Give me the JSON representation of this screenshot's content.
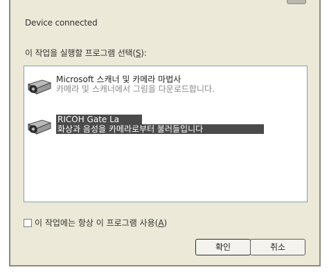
{
  "dialog": {
    "message": "Device connected",
    "prompt_label": "이 작업을 실행할 프로그램 선택(",
    "prompt_key": "S",
    "prompt_end": "):",
    "programs": [
      {
        "name": "Microsoft 스캐너 및 카메라 마법사",
        "description": "카메라 및 스캐너에서 그림을 다운로드합니다.",
        "selected": false,
        "icon": "camera-scanner-icon"
      },
      {
        "name": "RICOH Gate La",
        "description": "화상과 음성을 카메라로부터 불러들입니다",
        "selected": true,
        "icon": "camera-scanner-icon"
      }
    ],
    "always_use_label": "이 작업에는 항상 이 프로그램 사용(",
    "always_use_key": "A",
    "always_use_end": ")",
    "always_use_checked": false,
    "ok_label": "확인",
    "cancel_label": "취소"
  }
}
